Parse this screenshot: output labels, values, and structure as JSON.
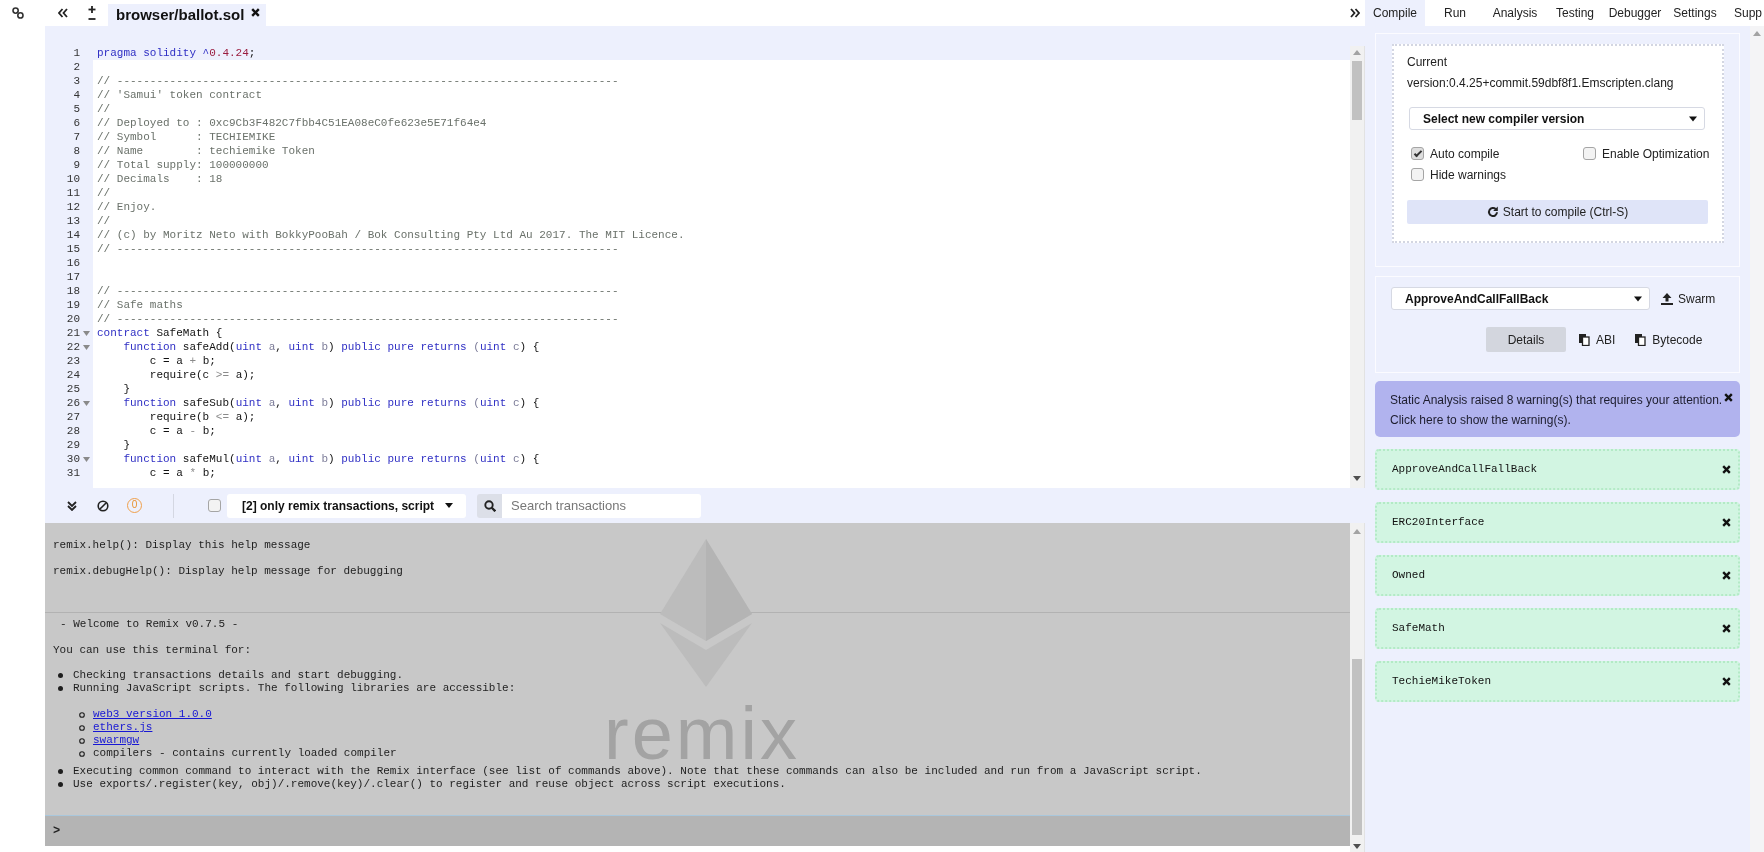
{
  "top_bar": {
    "file_tab": {
      "label": "browser/ballot.sol"
    }
  },
  "editor": {
    "lines": [
      {
        "number": "1",
        "active": true,
        "foldable": false,
        "tokens": [
          {
            "kind": "keyword",
            "text": "pragma solidity ^"
          },
          {
            "kind": "number",
            "text": "0.4.24"
          },
          {
            "kind": "plain",
            "text": ";"
          }
        ]
      },
      {
        "number": "2",
        "active": false,
        "foldable": false
      },
      {
        "number": "3",
        "active": false,
        "foldable": false,
        "tokens": [
          {
            "kind": "comment",
            "text": "// ----------------------------------------------------------------------------"
          }
        ]
      },
      {
        "number": "4",
        "active": false,
        "foldable": false,
        "tokens": [
          {
            "kind": "comment",
            "text": "// 'Samui' token contract"
          }
        ]
      },
      {
        "number": "5",
        "active": false,
        "foldable": false,
        "tokens": [
          {
            "kind": "comment",
            "text": "//"
          }
        ]
      },
      {
        "number": "6",
        "active": false,
        "foldable": false,
        "tokens": [
          {
            "kind": "comment",
            "text": "// Deployed to : 0xc9Cb3F482C7fbb4C51EA08eC0fe623e5E71f64e4"
          }
        ]
      },
      {
        "number": "7",
        "active": false,
        "foldable": false,
        "tokens": [
          {
            "kind": "comment",
            "text": "// Symbol      : TECHIEMIKE"
          }
        ]
      },
      {
        "number": "8",
        "active": false,
        "foldable": false,
        "tokens": [
          {
            "kind": "comment",
            "text": "// Name        : techiemike Token"
          }
        ]
      },
      {
        "number": "9",
        "active": false,
        "foldable": false,
        "tokens": [
          {
            "kind": "comment",
            "text": "// Total supply: 100000000"
          }
        ]
      },
      {
        "number": "10",
        "active": false,
        "foldable": false,
        "tokens": [
          {
            "kind": "comment",
            "text": "// Decimals    : 18"
          }
        ]
      },
      {
        "number": "11",
        "active": false,
        "foldable": false,
        "tokens": [
          {
            "kind": "comment",
            "text": "//"
          }
        ]
      },
      {
        "number": "12",
        "active": false,
        "foldable": false,
        "tokens": [
          {
            "kind": "comment",
            "text": "// Enjoy."
          }
        ]
      },
      {
        "number": "13",
        "active": false,
        "foldable": false,
        "tokens": [
          {
            "kind": "comment",
            "text": "//"
          }
        ]
      },
      {
        "number": "14",
        "active": false,
        "foldable": false,
        "tokens": [
          {
            "kind": "comment",
            "text": "// (c) by Moritz Neto with BokkyPooBah / Bok Consulting Pty Ltd Au 2017. The MIT Licence."
          }
        ]
      },
      {
        "number": "15",
        "active": false,
        "foldable": false,
        "tokens": [
          {
            "kind": "comment",
            "text": "// ----------------------------------------------------------------------------"
          }
        ]
      },
      {
        "number": "16",
        "active": false,
        "foldable": false
      },
      {
        "number": "17",
        "active": false,
        "foldable": false
      },
      {
        "number": "18",
        "active": false,
        "foldable": false,
        "tokens": [
          {
            "kind": "comment",
            "text": "// ----------------------------------------------------------------------------"
          }
        ]
      },
      {
        "number": "19",
        "active": false,
        "foldable": false,
        "tokens": [
          {
            "kind": "comment",
            "text": "// Safe maths"
          }
        ]
      },
      {
        "number": "20",
        "active": false,
        "foldable": false,
        "tokens": [
          {
            "kind": "comment",
            "text": "// ----------------------------------------------------------------------------"
          }
        ]
      },
      {
        "number": "21",
        "active": false,
        "foldable": true,
        "tokens": [
          {
            "kind": "keyword",
            "text": "contract"
          },
          {
            "kind": "plain",
            "text": " SafeMath {"
          }
        ]
      },
      {
        "number": "22",
        "active": false,
        "foldable": true,
        "tokens": [
          {
            "kind": "keyword",
            "text": "    function"
          },
          {
            "kind": "plain",
            "text": " safeAdd("
          },
          {
            "kind": "keyword",
            "text": "uint"
          },
          {
            "kind": "param",
            "text": " a"
          },
          {
            "kind": "plain",
            "text": ", "
          },
          {
            "kind": "keyword",
            "text": "uint"
          },
          {
            "kind": "param",
            "text": " b"
          },
          {
            "kind": "plain",
            "text": ") "
          },
          {
            "kind": "keyword",
            "text": "public pure returns"
          },
          {
            "kind": "param",
            "text": " ("
          },
          {
            "kind": "keyword",
            "text": "uint"
          },
          {
            "kind": "param",
            "text": " c"
          },
          {
            "kind": "plain",
            "text": ") {"
          }
        ]
      },
      {
        "number": "23",
        "active": false,
        "foldable": false,
        "tokens": [
          {
            "kind": "plain",
            "text": "        c = a "
          },
          {
            "kind": "operator",
            "text": "+"
          },
          {
            "kind": "plain",
            "text": " b;"
          }
        ]
      },
      {
        "number": "24",
        "active": false,
        "foldable": false,
        "tokens": [
          {
            "kind": "plain",
            "text": "        require(c "
          },
          {
            "kind": "operator",
            "text": ">="
          },
          {
            "kind": "plain",
            "text": " a);"
          }
        ]
      },
      {
        "number": "25",
        "active": false,
        "foldable": false,
        "tokens": [
          {
            "kind": "plain",
            "text": "    }"
          }
        ]
      },
      {
        "number": "26",
        "active": false,
        "foldable": true,
        "tokens": [
          {
            "kind": "keyword",
            "text": "    function"
          },
          {
            "kind": "plain",
            "text": " safeSub("
          },
          {
            "kind": "keyword",
            "text": "uint"
          },
          {
            "kind": "param",
            "text": " a"
          },
          {
            "kind": "plain",
            "text": ", "
          },
          {
            "kind": "keyword",
            "text": "uint"
          },
          {
            "kind": "param",
            "text": " b"
          },
          {
            "kind": "plain",
            "text": ") "
          },
          {
            "kind": "keyword",
            "text": "public pure returns"
          },
          {
            "kind": "param",
            "text": " ("
          },
          {
            "kind": "keyword",
            "text": "uint"
          },
          {
            "kind": "param",
            "text": " c"
          },
          {
            "kind": "plain",
            "text": ") {"
          }
        ]
      },
      {
        "number": "27",
        "active": false,
        "foldable": false,
        "tokens": [
          {
            "kind": "plain",
            "text": "        require(b "
          },
          {
            "kind": "operator",
            "text": "<="
          },
          {
            "kind": "plain",
            "text": " a);"
          }
        ]
      },
      {
        "number": "28",
        "active": false,
        "foldable": false,
        "tokens": [
          {
            "kind": "plain",
            "text": "        c = a "
          },
          {
            "kind": "operator",
            "text": "-"
          },
          {
            "kind": "plain",
            "text": " b;"
          }
        ]
      },
      {
        "number": "29",
        "active": false,
        "foldable": false,
        "tokens": [
          {
            "kind": "plain",
            "text": "    }"
          }
        ]
      },
      {
        "number": "30",
        "active": false,
        "foldable": true,
        "tokens": [
          {
            "kind": "keyword",
            "text": "    function"
          },
          {
            "kind": "plain",
            "text": " safeMul("
          },
          {
            "kind": "keyword",
            "text": "uint"
          },
          {
            "kind": "param",
            "text": " a"
          },
          {
            "kind": "plain",
            "text": ", "
          },
          {
            "kind": "keyword",
            "text": "uint"
          },
          {
            "kind": "param",
            "text": " b"
          },
          {
            "kind": "plain",
            "text": ") "
          },
          {
            "kind": "keyword",
            "text": "public pure returns"
          },
          {
            "kind": "param",
            "text": " ("
          },
          {
            "kind": "keyword",
            "text": "uint"
          },
          {
            "kind": "param",
            "text": " c"
          },
          {
            "kind": "plain",
            "text": ") {"
          }
        ]
      },
      {
        "number": "31",
        "active": false,
        "foldable": false,
        "tokens": [
          {
            "kind": "plain",
            "text": "        c = a "
          },
          {
            "kind": "operator",
            "text": "*"
          },
          {
            "kind": "plain",
            "text": " b;"
          }
        ]
      }
    ]
  },
  "terminal": {
    "toolbar": {
      "pending_count": "0",
      "checked": false,
      "filter": "[2] only remix transactions, script",
      "search": {
        "placeholder": "Search transactions"
      }
    },
    "help_lines": [
      "remix.help(): Display this help message",
      "remix.debugHelp(): Display help message for debugging"
    ],
    "welcome": "- Welcome to Remix v0.7.5 -",
    "intro": "You can use this terminal for:",
    "items": [
      {
        "text": "Checking transactions details and start debugging."
      },
      {
        "text": "Running JavaScript scripts. The following libraries are accessible:",
        "children": [
          {
            "kind": "link",
            "text": "web3 version 1.0.0"
          },
          {
            "kind": "link",
            "text": "ethers.js"
          },
          {
            "kind": "link",
            "text": "swarmgw"
          },
          {
            "kind": "text",
            "text": "compilers - contains currently loaded compiler"
          }
        ]
      },
      {
        "text": "Executing common command to interact with the Remix interface (see list of commands above). Note that these commands can also be included and run from a JavaScript script."
      },
      {
        "text": "Use exports/.register(key, obj)/.remove(key)/.clear() to register and reuse object across script executions."
      }
    ],
    "watermark_text": "remix",
    "prompt": ">"
  },
  "side_panel": {
    "tabs": [
      {
        "label": "Compile",
        "selected": true
      },
      {
        "label": "Run",
        "selected": false
      },
      {
        "label": "Analysis",
        "selected": false
      },
      {
        "label": "Testing",
        "selected": false
      },
      {
        "label": "Debugger",
        "selected": false
      },
      {
        "label": "Settings",
        "selected": false
      },
      {
        "label": "Supp",
        "selected": false
      }
    ],
    "compiler": {
      "current_label": "Current",
      "version": "version:0.4.25+commit.59dbf8f1.Emscripten.clang",
      "version_select": "Select new compiler version",
      "options": [
        {
          "label": "Auto compile",
          "checked": true
        },
        {
          "label": "Enable Optimization",
          "checked": false
        },
        {
          "label": "Hide warnings",
          "checked": false
        }
      ],
      "compile_button": "Start to compile (Ctrl-S)"
    },
    "contract": {
      "select": "ApproveAndCallFallBack",
      "publish_button": "Swarm",
      "actions": [
        {
          "kind": "details",
          "label": "Details"
        },
        {
          "kind": "copy",
          "label": "ABI"
        },
        {
          "kind": "copy",
          "label": "Bytecode"
        }
      ]
    },
    "warning": {
      "lines": [
        "Static Analysis raised 8 warning(s) that requires your attention.",
        "Click here to show the warning(s)."
      ]
    },
    "contracts": [
      {
        "name": "ApproveAndCallFallBack"
      },
      {
        "name": "ERC20Interface"
      },
      {
        "name": "Owned"
      },
      {
        "name": "SafeMath"
      },
      {
        "name": "TechieMikeToken"
      }
    ]
  }
}
